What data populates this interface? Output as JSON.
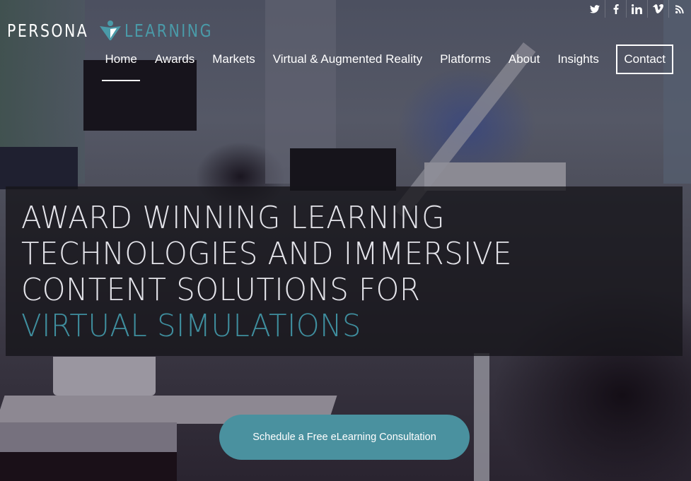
{
  "brand": {
    "name_part1": "PERSONA",
    "name_part2": "LEARNING",
    "accent_color": "#4a9aa8"
  },
  "social": [
    {
      "name": "twitter",
      "icon": "twitter-icon"
    },
    {
      "name": "facebook",
      "icon": "facebook-icon"
    },
    {
      "name": "linkedin",
      "icon": "linkedin-icon"
    },
    {
      "name": "vimeo",
      "icon": "vimeo-icon"
    },
    {
      "name": "rss",
      "icon": "rss-icon"
    }
  ],
  "nav": {
    "items": [
      {
        "label": "Home",
        "active": true
      },
      {
        "label": "Awards"
      },
      {
        "label": "Markets"
      },
      {
        "label": "Virtual & Augmented Reality"
      },
      {
        "label": "Platforms"
      },
      {
        "label": "About"
      },
      {
        "label": "Insights"
      },
      {
        "label": "Contact",
        "style": "outlined"
      }
    ]
  },
  "hero": {
    "headline_lines": [
      "AWARD WINNING LEARNING",
      "TECHNOLOGIES AND IMMERSIVE",
      "CONTENT SOLUTIONS FOR"
    ],
    "headline_accent": "VIRTUAL SIMULATIONS",
    "accent_color": "#3f8e9e",
    "cta_label": "Schedule a Free eLearning Consultation",
    "cta_color": "#4a919f"
  }
}
